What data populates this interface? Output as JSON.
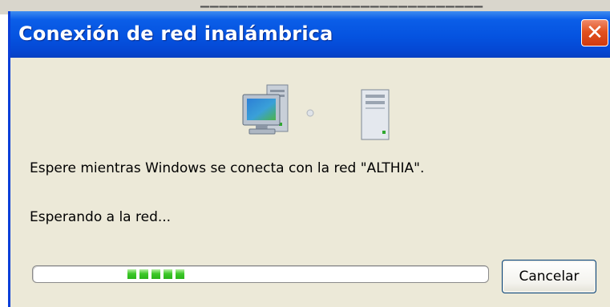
{
  "dialog": {
    "title": "Conexión de red inalámbrica",
    "message": "Espere mientras Windows se conecta con la red \"ALTHIA\".",
    "status": "Esperando a la red...",
    "progress_blocks": 5,
    "cancel_label": "Cancelar"
  },
  "icons": {
    "computer": "computer-icon",
    "connection": "connection-dot-icon",
    "server": "server-tower-icon",
    "close": "close-icon"
  },
  "colors": {
    "titlebar": "#0553e0",
    "dialog_bg": "#ece9d8",
    "close": "#e2521f",
    "progress": "#3ec82a"
  }
}
